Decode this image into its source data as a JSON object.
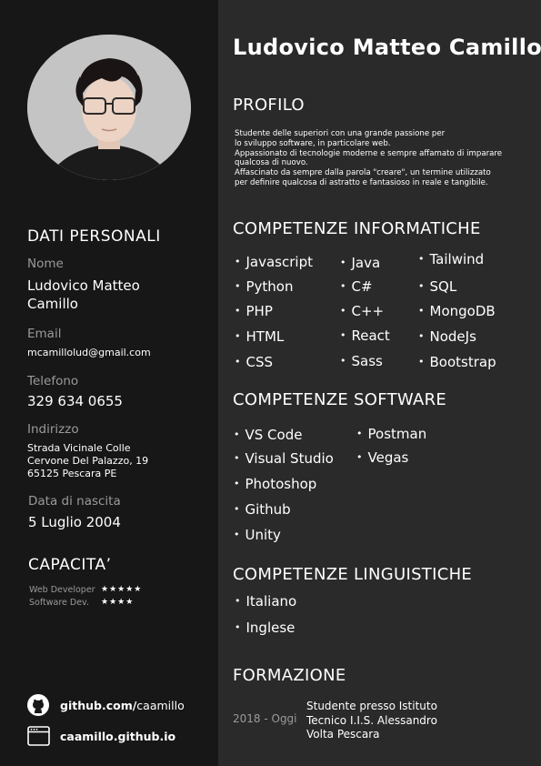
{
  "name": "Ludovico Matteo Camillo",
  "sidebar": {
    "personal_title": "DATI PERSONALI",
    "fields": {
      "nome_label": "Nome",
      "nome_value": "Ludovico Matteo Camillo",
      "email_label": "Email",
      "email_value": "mcamillolud@gmail.com",
      "telefono_label": "Telefono",
      "telefono_value": "329 634 0655",
      "indirizzo_label": "Indirizzo",
      "indirizzo_value": "Strada Vicinale Colle Cervone Del Palazzo, 19 65125 Pescara PE",
      "nascita_label": "Data di nascita",
      "nascita_value": "5 Luglio 2004"
    },
    "capacita_title": "CAPACITA’",
    "skills": [
      {
        "label": "Web Developer",
        "stars": "★★★★★",
        "rating": 5
      },
      {
        "label": "Software Dev.",
        "stars": "★★★★",
        "rating": 4
      }
    ],
    "links": {
      "github_bold": "github.com/",
      "github_rest": "caamillo",
      "site": "caamillo.github.io"
    }
  },
  "profilo": {
    "title": "PROFILO",
    "lines": [
      "Studente delle superiori con una grande passione per",
      "lo sviluppo software, in particolare web.",
      "Appassionato di tecnologie moderne e sempre affamato di imparare",
      "qualcosa di nuovo.",
      "Affascinato da sempre dalla parola \"creare\", un termine utilizzato",
      "per definire qualcosa di astratto e fantasioso in reale e tangibile."
    ]
  },
  "competenze_informatiche": {
    "title": "COMPETENZE INFORMATICHE",
    "col1": [
      "Javascript",
      "Python",
      "PHP",
      "HTML",
      "CSS"
    ],
    "col2": [
      "Java",
      "C#",
      "C++",
      "React",
      "Sass"
    ],
    "col3": [
      "Tailwind",
      "SQL",
      "MongoDB",
      "NodeJs",
      "Bootstrap"
    ]
  },
  "competenze_software": {
    "title": "COMPETENZE SOFTWARE",
    "col1": [
      "VS Code",
      "Visual Studio",
      "Photoshop",
      "Github",
      "Unity"
    ],
    "col2": [
      "Postman",
      "Vegas"
    ]
  },
  "competenze_linguistiche": {
    "title": "COMPETENZE LINGUISTICHE",
    "items": [
      "Italiano",
      "Inglese"
    ]
  },
  "formazione": {
    "title": "FORMAZIONE",
    "year": "2018 - Oggi",
    "desc": "Studente presso Istituto Tecnico I.I.S. Alessandro Volta Pescara"
  }
}
